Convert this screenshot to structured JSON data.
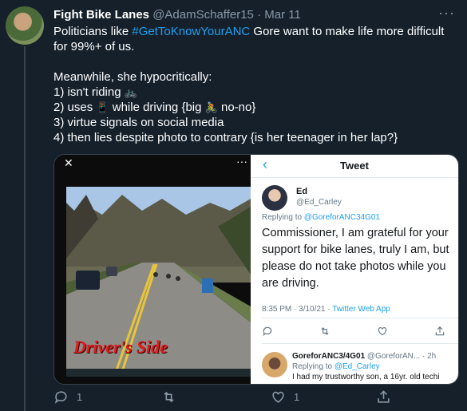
{
  "tweet": {
    "display_name": "Fight Bike Lanes",
    "handle": "@AdamSchaffer15",
    "separator": "·",
    "date": "Mar 11",
    "line1_pre": "Politicians like ",
    "hashtag": "#GetToKnowYourANC",
    "line1_post": " Gore want to make life more difficult for 99%+ of us.",
    "line2": "Meanwhile, she hypocritically:",
    "item1": "1) isn't riding",
    "item1_emoji": "🚲",
    "item2_pre": "2) uses",
    "item2_emoji": "📱",
    "item2_mid": "while driving {big",
    "item2_emoji2": "🚴",
    "item2_post": "no-no}",
    "item3": "3) virtue signals on social media",
    "item4": "4) then lies despite photo to contrary {is her teenager in her lap?}"
  },
  "media": {
    "photo_caption": "Driver's Side",
    "screenshot": {
      "title": "Tweet",
      "name": "Ed",
      "handle": "@Ed_Carley",
      "replying_label": "Replying to",
      "replying_to": "@GoreforANC34G01",
      "body": "Commissioner, I am grateful for your support for bike lanes, truly I am, but please do not take photos while you are driving.",
      "time": "8:35 PM · 3/10/21 ·",
      "source": "Twitter Web App",
      "reply_name": "GoreforANC3/4G01",
      "reply_handle": "@GoreforAN...",
      "reply_time": "· 2h",
      "reply_replying_label": "Replying to",
      "reply_replying_to": "@Ed_Carley",
      "reply_text": "I had my trustworthy son, a 16yr. old techi"
    }
  },
  "actions": {
    "reply_count": "1",
    "retweet_count": "",
    "like_count": "1"
  },
  "colors": {
    "background": "#15202b",
    "accent": "#1da1f2",
    "muted": "#8899a6",
    "caption_red": "#e31b1b"
  }
}
